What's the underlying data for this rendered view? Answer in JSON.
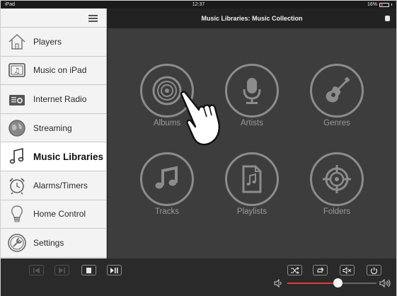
{
  "status_bar": {
    "device": "iPad",
    "time": "12:37",
    "battery": "16%"
  },
  "header": {
    "title": "Music Libraries: Music Collection"
  },
  "sidebar": {
    "items": [
      {
        "label": "Players",
        "icon": "house-icon"
      },
      {
        "label": "Music on iPad",
        "icon": "music-note-box-icon"
      },
      {
        "label": "Internet Radio",
        "icon": "radio-icon"
      },
      {
        "label": "Streaming",
        "icon": "globe-icon"
      },
      {
        "label": "Music Libraries",
        "icon": "music-notes-icon",
        "active": true
      },
      {
        "label": "Alarms/Timers",
        "icon": "alarm-clock-icon"
      },
      {
        "label": "Home Control",
        "icon": "lightbulb-icon"
      },
      {
        "label": "Settings",
        "icon": "wrench-icon"
      }
    ]
  },
  "library": {
    "tiles": [
      {
        "label": "Albums",
        "icon": "disc-icon"
      },
      {
        "label": "Artists",
        "icon": "microphone-icon"
      },
      {
        "label": "Genres",
        "icon": "guitar-icon"
      },
      {
        "label": "Tracks",
        "icon": "music-notes-icon"
      },
      {
        "label": "Playlists",
        "icon": "playlist-file-icon"
      },
      {
        "label": "Folders",
        "icon": "target-icon"
      }
    ]
  },
  "transport": {
    "buttons": [
      "previous",
      "next",
      "stop",
      "play-pause"
    ],
    "right_buttons": [
      "shuffle",
      "repeat",
      "mute",
      "power"
    ],
    "volume_level": 0.56,
    "volume_color": "#e03a3a"
  },
  "colors": {
    "background": "#3d3d3d",
    "sidebar": "#f1f1f1",
    "accent": "#e03a3a"
  }
}
